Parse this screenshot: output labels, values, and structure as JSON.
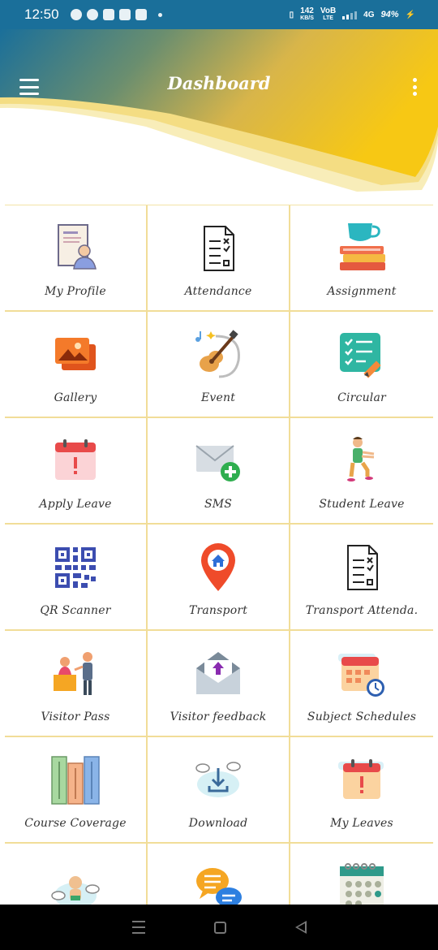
{
  "status_bar": {
    "time": "12:50",
    "speed_value": "142",
    "speed_unit": "KB/S",
    "volte_top": "VoB",
    "volte_bottom": "LTE",
    "network": "4G",
    "battery": "94%"
  },
  "header": {
    "title": "Dashboard",
    "gradient_start": "#1a6f9a",
    "gradient_end": "#f7c814"
  },
  "tiles": [
    {
      "label": "My Profile",
      "icon": "profile-document-icon"
    },
    {
      "label": "Attendance",
      "icon": "checklist-document-icon"
    },
    {
      "label": "Assignment",
      "icon": "books-cup-icon"
    },
    {
      "label": "Gallery",
      "icon": "photo-gallery-icon"
    },
    {
      "label": "Event",
      "icon": "guitar-music-icon"
    },
    {
      "label": "Circular",
      "icon": "checklist-pencil-icon"
    },
    {
      "label": "Apply Leave",
      "icon": "calendar-alert-icon"
    },
    {
      "label": "SMS",
      "icon": "envelope-plus-icon"
    },
    {
      "label": "Student Leave",
      "icon": "student-walking-icon"
    },
    {
      "label": "QR Scanner",
      "icon": "qr-code-icon"
    },
    {
      "label": "Transport",
      "icon": "location-pin-icon"
    },
    {
      "label": "Transport Attenda.",
      "icon": "checklist-document-icon"
    },
    {
      "label": "Visitor Pass",
      "icon": "visitor-desk-icon"
    },
    {
      "label": "Visitor feedback",
      "icon": "envelope-upload-icon"
    },
    {
      "label": "Subject Schedules",
      "icon": "calendar-clock-icon"
    },
    {
      "label": "Course Coverage",
      "icon": "books-shelf-icon"
    },
    {
      "label": "Download",
      "icon": "cloud-download-icon"
    },
    {
      "label": "My Leaves",
      "icon": "calendar-alert-icon"
    },
    {
      "label": "",
      "icon": "baby-clouds-icon"
    },
    {
      "label": "",
      "icon": "chat-bubbles-icon"
    },
    {
      "label": "",
      "icon": "calendar-grid-icon"
    }
  ]
}
